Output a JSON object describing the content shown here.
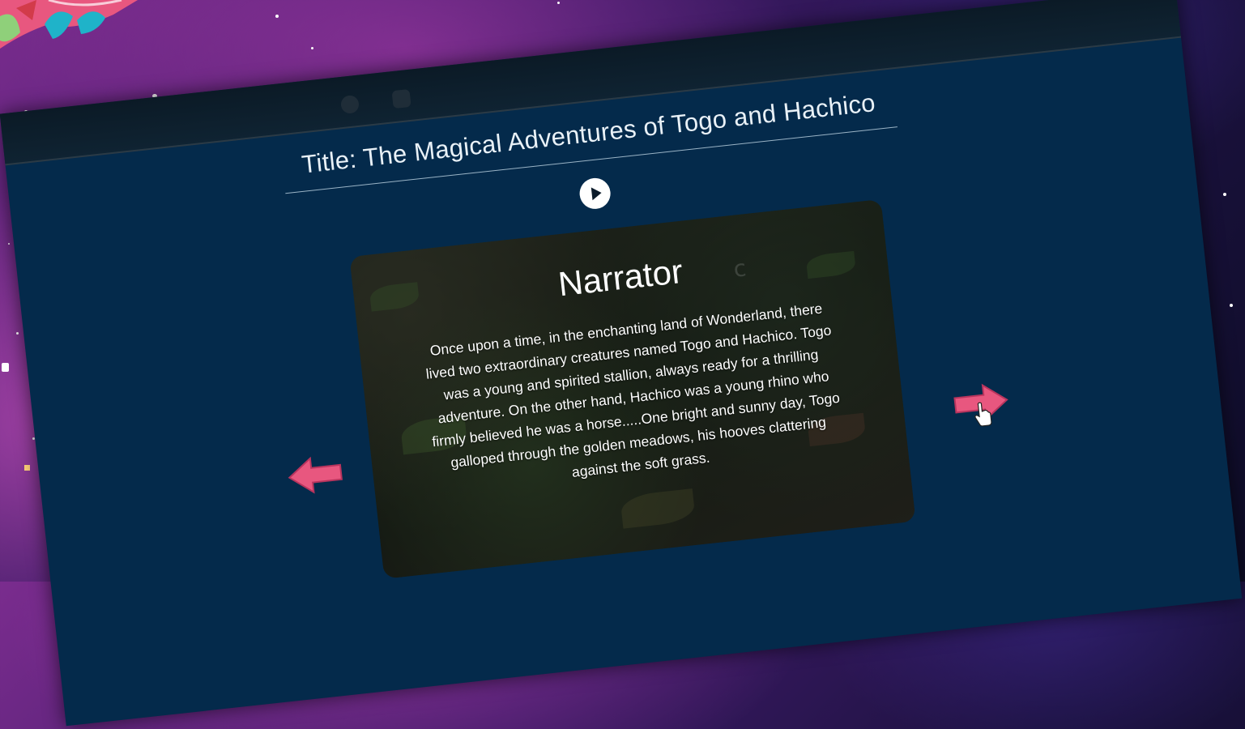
{
  "story": {
    "title": "Title: The Magical Adventures of Togo and Hachico",
    "speaker": "Narrator",
    "text": "Once upon a time, in the enchanting land of Wonderland, there lived two extraordinary creatures named Togo and Hachico. Togo was a young and spirited stallion, always ready for a thrilling adventure. On the other hand, Hachico was a young rhino who firmly believed he was a horse.....One bright and sunny day, Togo galloped through the golden meadows, his hooves clattering against the soft grass."
  },
  "controls": {
    "play_icon": "play-icon",
    "prev_icon": "arrow-left-icon",
    "next_icon": "arrow-right-icon",
    "cursor_icon": "hand-pointer-icon"
  },
  "colors": {
    "window_bg": "#042a4b",
    "arrow": "#e8577f",
    "text": "#ffffff"
  }
}
